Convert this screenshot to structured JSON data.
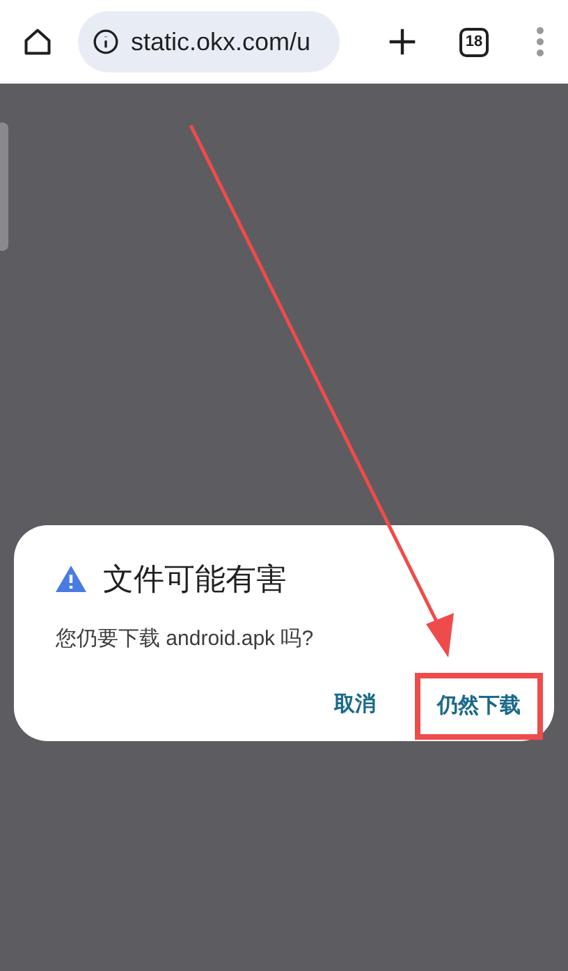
{
  "toolbar": {
    "url": "static.okx.com/u",
    "tab_count": "18"
  },
  "dialog": {
    "title": "文件可能有害",
    "message": "您仍要下载 android.apk 吗?",
    "buttons": [
      {
        "label": "取消",
        "highlighted": false
      },
      {
        "label": "仍然下载",
        "highlighted": true
      }
    ]
  }
}
